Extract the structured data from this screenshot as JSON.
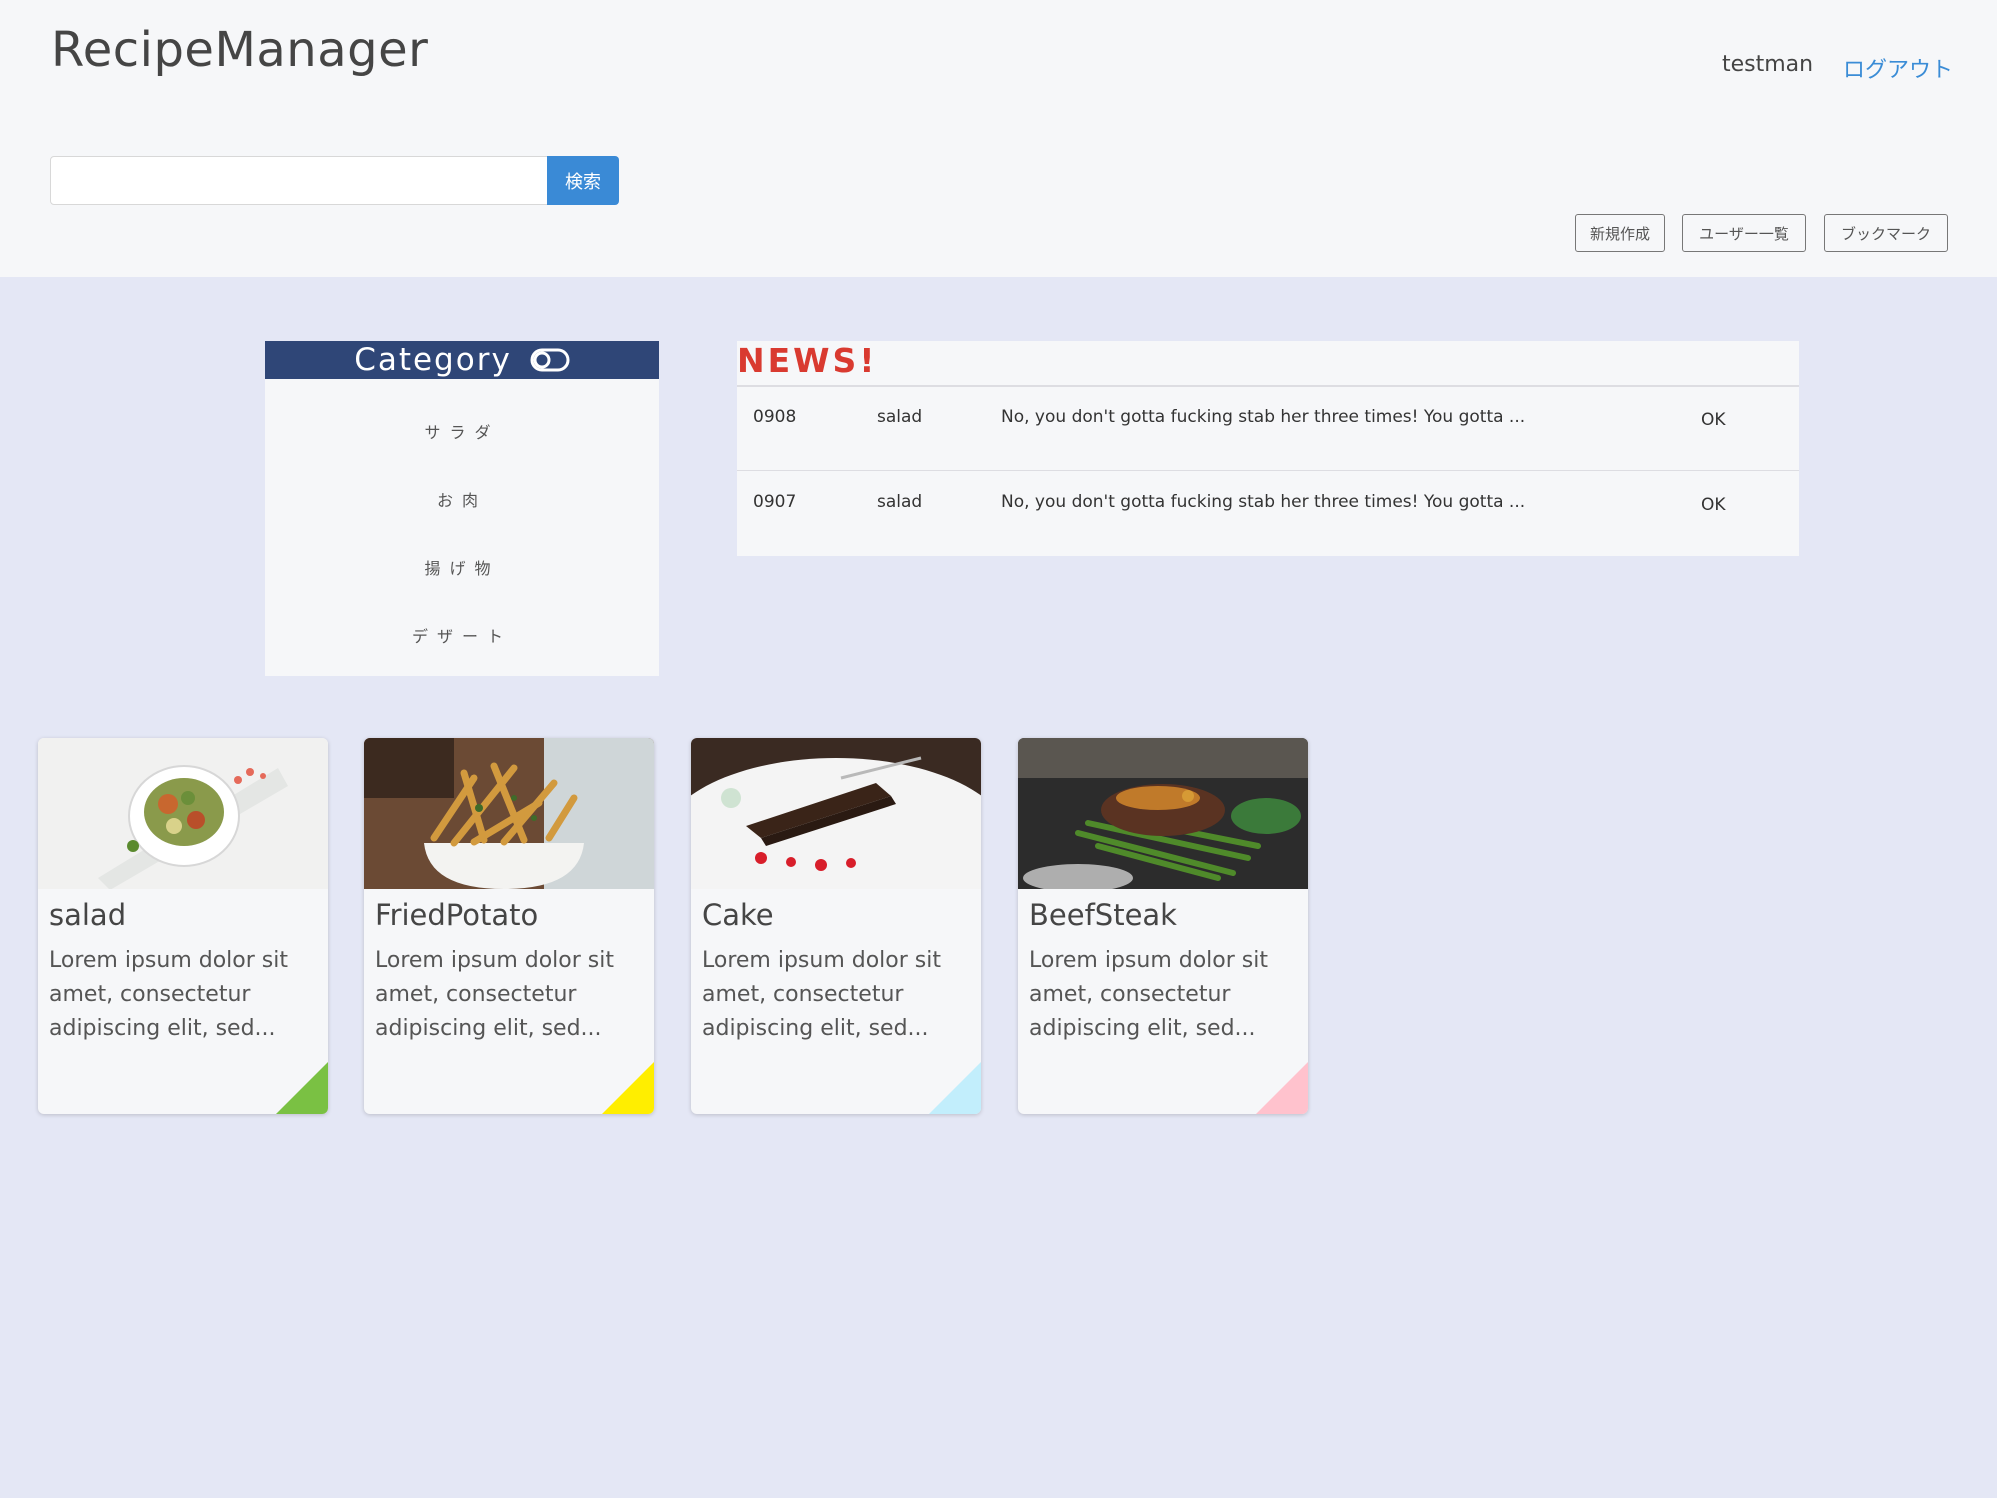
{
  "header": {
    "brand": "RecipeManager",
    "user": "testman",
    "logout": "ログアウト",
    "search": {
      "placeholder": "",
      "button": "検索"
    },
    "nav": {
      "new": "新規作成",
      "users": "ユーザー一覧",
      "bookmarks": "ブックマーク"
    }
  },
  "category": {
    "title": "Category",
    "icon": "toggle-icon",
    "items": [
      "サラダ",
      "お肉",
      "揚げ物",
      "デザート"
    ]
  },
  "news": {
    "title": "NEWS!",
    "rows": [
      {
        "id": "0908",
        "category": "salad",
        "message": "No, you don't gotta fucking stab her three times! You gotta ...",
        "action": "OK"
      },
      {
        "id": "0907",
        "category": "salad",
        "message": "No, you don't gotta fucking stab her three times! You gotta ...",
        "action": "OK"
      }
    ]
  },
  "recipes": [
    {
      "title": "salad",
      "desc": "Lorem ipsum dolor sit amet, consectetur adipiscing elit, sed...",
      "corner_color": "#7ac143",
      "image": "salad-photo"
    },
    {
      "title": "FriedPotato",
      "desc": "Lorem ipsum dolor sit amet, consectetur adipiscing elit, sed...",
      "corner_color": "#ffee00",
      "image": "fries-photo"
    },
    {
      "title": "Cake",
      "desc": "Lorem ipsum dolor sit amet, consectetur adipiscing elit, sed...",
      "corner_color": "#c2eefc",
      "image": "cake-photo"
    },
    {
      "title": "BeefSteak",
      "desc": "Lorem ipsum dolor sit amet, consectetur adipiscing elit, sed...",
      "corner_color": "#ffc2cd",
      "image": "steak-photo"
    }
  ],
  "colors": {
    "accent": "#3a8ad6",
    "category_header": "#2f4677",
    "news_title": "#d93a30",
    "page_bg": "#e4e7f5"
  }
}
